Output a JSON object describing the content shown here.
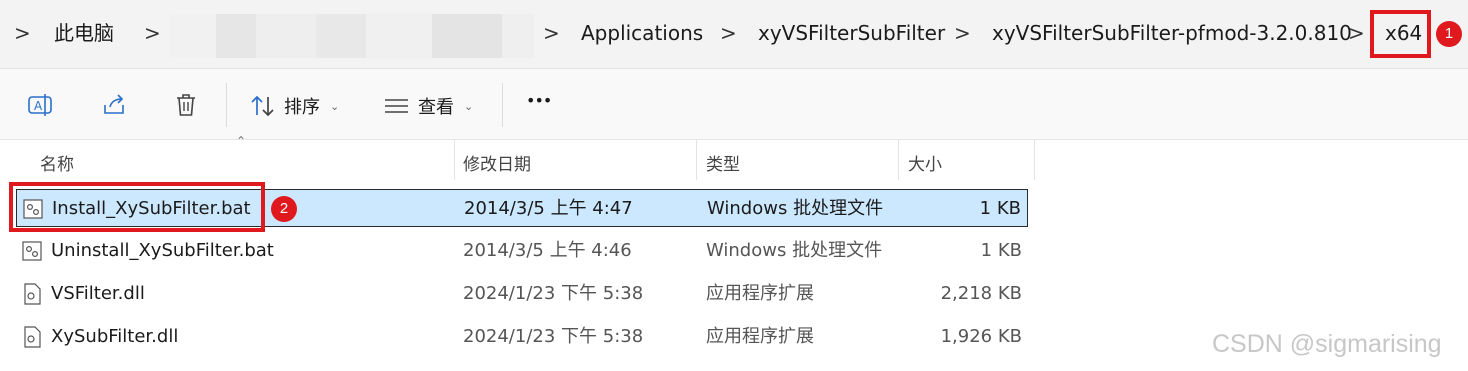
{
  "breadcrumb": {
    "items": [
      "此电脑",
      "Applications",
      "xyVSFilterSubFilter",
      "xyVSFilterSubFilter-pfmod-3.2.0.810",
      "x64"
    ],
    "separator": ">"
  },
  "toolbar": {
    "sort_label": "排序",
    "view_label": "查看",
    "more_label": "•••"
  },
  "columns": [
    "名称",
    "修改日期",
    "类型",
    "大小"
  ],
  "files": [
    {
      "name": "Install_XySubFilter.bat",
      "modified": "2014/3/5 上午 4:47",
      "type": "Windows 批处理文件",
      "size": "1 KB"
    },
    {
      "name": "Uninstall_XySubFilter.bat",
      "modified": "2014/3/5 上午 4:46",
      "type": "Windows 批处理文件",
      "size": "1 KB"
    },
    {
      "name": "VSFilter.dll",
      "modified": "2024/1/23 下午 5:38",
      "type": "应用程序扩展",
      "size": "2,218 KB"
    },
    {
      "name": "XySubFilter.dll",
      "modified": "2024/1/23 下午 5:38",
      "type": "应用程序扩展",
      "size": "1,926 KB"
    }
  ],
  "annotations": {
    "badge1": "1",
    "badge2": "2"
  },
  "watermark": "CSDN @sigmarising",
  "colors": {
    "highlight": "#e0191f",
    "selection": "#cce8ff"
  }
}
